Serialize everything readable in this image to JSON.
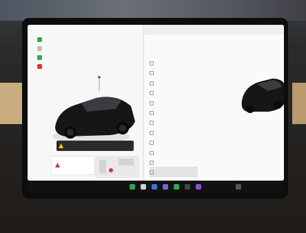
{
  "status": {
    "left_time": "",
    "right_text": ""
  },
  "car_labels": {
    "left_label": "",
    "right_label": ""
  },
  "alert": {
    "text": ""
  },
  "bottom_card": {
    "text": ""
  },
  "right_pane": {
    "search": "",
    "profile": "",
    "menu": [
      "",
      "",
      "",
      "",
      "",
      "",
      "",
      "",
      "",
      "",
      "",
      "",
      ""
    ],
    "detail_lines": [
      "",
      "",
      ""
    ],
    "detail_link": ""
  },
  "taskbar": {
    "temp": ""
  },
  "colors": {
    "accent_blue": "#3b6fd6",
    "alert_yellow": "#f5c518",
    "warn_red": "#e03030"
  }
}
